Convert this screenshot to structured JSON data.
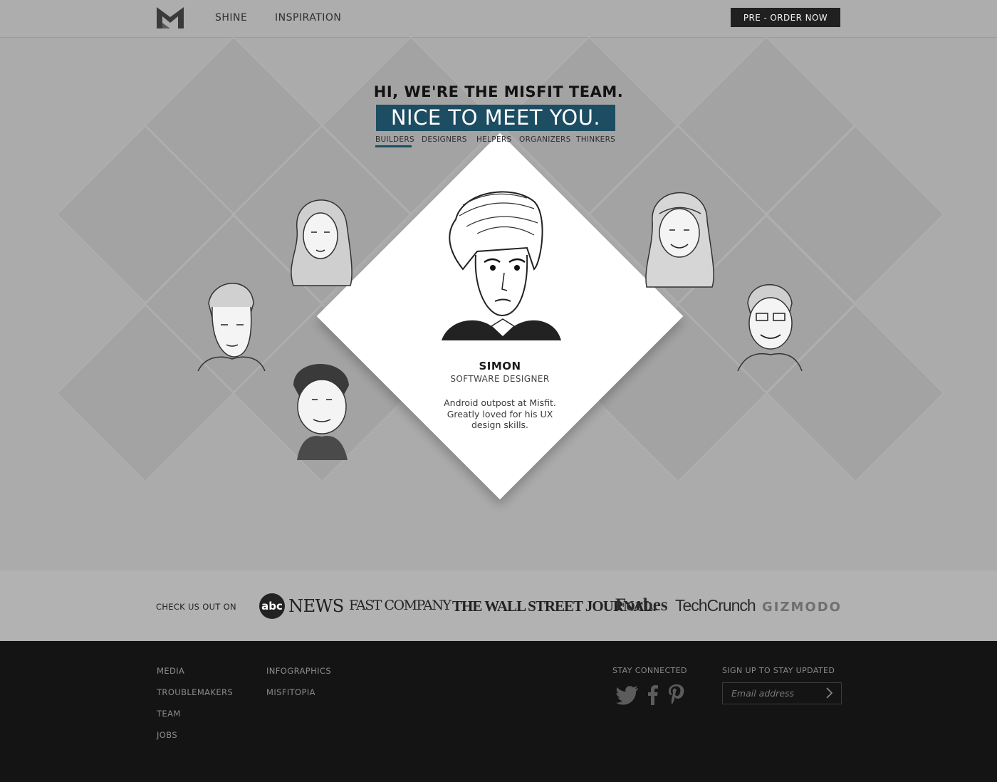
{
  "header": {
    "nav": [
      {
        "label": "SHINE"
      },
      {
        "label": "INSPIRATION"
      }
    ],
    "preorder_label": "PRE - ORDER NOW"
  },
  "hero": {
    "heading_line1": "HI, WE'RE THE MISFIT TEAM.",
    "heading_line2": "NICE TO MEET YOU.",
    "tabs": [
      {
        "label": "BUILDERS",
        "active": true
      },
      {
        "label": "DESIGNERS"
      },
      {
        "label": "HELPERS"
      },
      {
        "label": "ORGANIZERS"
      },
      {
        "label": "THINKERS"
      }
    ],
    "active_member": {
      "name": "SIMON",
      "role": "SOFTWARE DESIGNER",
      "bio": "Android outpost at Misfit. Greatly loved for his UX design skills."
    },
    "accent_color": "#1c4d63"
  },
  "press": {
    "label": "CHECK US OUT ON",
    "logos": [
      {
        "badge": "abc",
        "text": "NEWS"
      },
      {
        "text": "FAST COMPANY"
      },
      {
        "text": "THE WALL STREET JOURNAL."
      },
      {
        "text": "Forbes"
      },
      {
        "text": "TechCrunch"
      },
      {
        "text": "GIZMODO"
      }
    ]
  },
  "footer": {
    "col1": [
      "MEDIA",
      "TROUBLEMAKERS",
      "TEAM",
      "JOBS"
    ],
    "col2": [
      "INFOGRAPHICS",
      "MISFITOPIA"
    ],
    "stay_connected": "STAY CONNECTED",
    "social": [
      "twitter-icon",
      "facebook-icon",
      "pinterest-icon"
    ],
    "signup_heading": "SIGN UP TO STAY UPDATED",
    "email_placeholder": "Email address"
  }
}
